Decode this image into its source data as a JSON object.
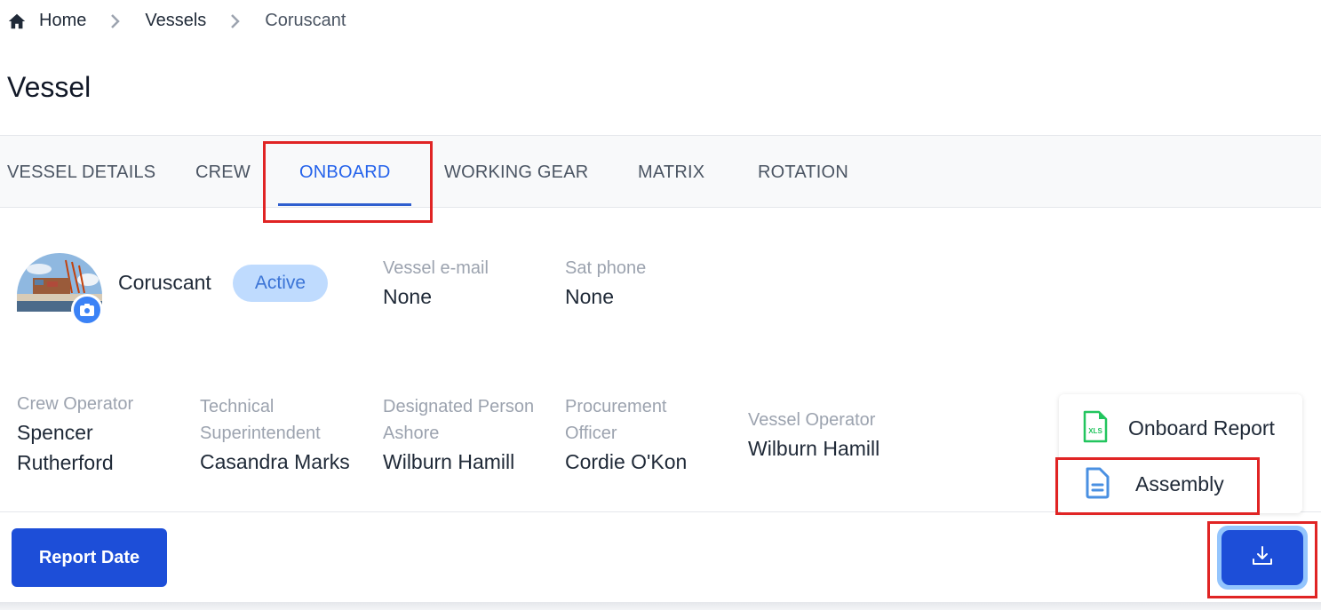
{
  "breadcrumb": {
    "items": [
      "Home",
      "Vessels",
      "Coruscant"
    ]
  },
  "page_title": "Vessel",
  "tabs": [
    {
      "label": "VESSEL DETAILS",
      "active": false
    },
    {
      "label": "CREW",
      "active": false
    },
    {
      "label": "ONBOARD",
      "active": true
    },
    {
      "label": "WORKING GEAR",
      "active": false
    },
    {
      "label": "MATRIX",
      "active": false
    },
    {
      "label": "ROTATION",
      "active": false
    }
  ],
  "vessel": {
    "name": "Coruscant",
    "status": "Active",
    "email_label": "Vessel e-mail",
    "email_value": "None",
    "sat_phone_label": "Sat phone",
    "sat_phone_value": "None"
  },
  "contacts": [
    {
      "label": "Crew Operator",
      "value": "Spencer Rutherford"
    },
    {
      "label": "Technical Superintendent",
      "value": "Casandra Marks"
    },
    {
      "label": "Designated Person Ashore",
      "value": "Wilburn Hamill"
    },
    {
      "label": "Procurement Officer",
      "value": "Cordie O'Kon"
    },
    {
      "label": "Vessel Operator",
      "value": "Wilburn Hamill"
    }
  ],
  "footer": {
    "report_date_label": "Report Date"
  },
  "download_menu": {
    "items": [
      {
        "label": "Onboard Report",
        "icon": "xls-file-icon",
        "icon_text": "XLS"
      },
      {
        "label": "Assembly",
        "icon": "document-icon"
      }
    ]
  },
  "colors": {
    "primary": "#1d4ed8",
    "active_tab": "#2563eb",
    "highlight": "#e02424",
    "badge_bg": "#bfdbfe",
    "xls_green": "#22c55e"
  }
}
